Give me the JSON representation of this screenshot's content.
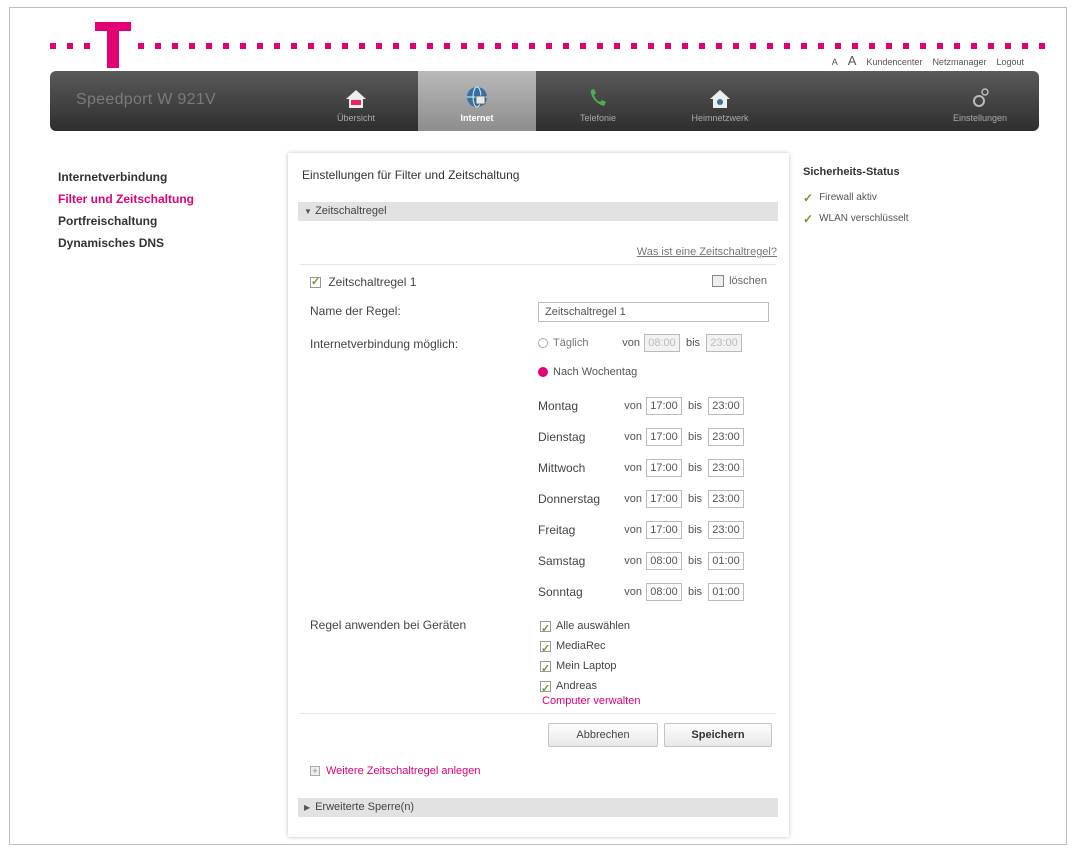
{
  "header": {
    "font_small": "A",
    "font_large": "A",
    "links": [
      "Kundencenter",
      "Netzmanager",
      "Logout"
    ]
  },
  "navbar": {
    "brand": "Speedport W 921V",
    "tabs": [
      {
        "label": "Übersicht",
        "icon": "house-icon"
      },
      {
        "label": "Internet",
        "icon": "globe-icon",
        "active": true
      },
      {
        "label": "Telefonie",
        "icon": "phone-icon"
      },
      {
        "label": "Heimnetzwerk",
        "icon": "home-network-icon"
      },
      {
        "label": "Einstellungen",
        "icon": "settings-icon"
      }
    ]
  },
  "sidebar": {
    "items": [
      {
        "label": "Internetverbindung",
        "active": false
      },
      {
        "label": "Filter und Zeitschaltung",
        "active": true
      },
      {
        "label": "Portfreischaltung",
        "active": false
      },
      {
        "label": "Dynamisches DNS",
        "active": false
      }
    ]
  },
  "main": {
    "title": "Einstellungen für Filter und Zeitschaltung",
    "section_rule": "Zeitschaltregel",
    "help_link": "Was ist eine Zeitschaltregel?",
    "rule": {
      "title": "Zeitschaltregel 1",
      "enabled": true,
      "delete_label": "löschen",
      "name_label": "Name der Regel:",
      "name_value": "Zeitschaltregel 1",
      "connection_label": "Internetverbindung möglich:",
      "daily_label": "Täglich",
      "daily_from": "08:00",
      "daily_to": "23:00",
      "weekday_label": "Nach Wochentag",
      "von": "von",
      "bis": "bis",
      "days": [
        {
          "day": "Montag",
          "from": "17:00",
          "to": "23:00"
        },
        {
          "day": "Dienstag",
          "from": "17:00",
          "to": "23:00"
        },
        {
          "day": "Mittwoch",
          "from": "17:00",
          "to": "23:00"
        },
        {
          "day": "Donnerstag",
          "from": "17:00",
          "to": "23:00"
        },
        {
          "day": "Freitag",
          "from": "17:00",
          "to": "23:00"
        },
        {
          "day": "Samstag",
          "from": "08:00",
          "to": "01:00"
        },
        {
          "day": "Sonntag",
          "from": "08:00",
          "to": "01:00"
        }
      ],
      "devices_label": "Regel anwenden bei Geräten",
      "devices": [
        {
          "label": "Alle auswählen",
          "checked": true
        },
        {
          "label": "MediaRec",
          "checked": true
        },
        {
          "label": "Mein Laptop",
          "checked": true
        },
        {
          "label": "Andreas",
          "checked": true
        }
      ],
      "manage_link": "Computer verwalten"
    },
    "cancel_button": "Abbrechen",
    "save_button": "Speichern",
    "add_rule": "Weitere Zeitschaltregel anlegen",
    "section_advanced": "Erweiterte Sperre(n)"
  },
  "status": {
    "title": "Sicherheits-Status",
    "items": [
      "Firewall aktiv",
      "WLAN verschlüsselt"
    ]
  },
  "colors": {
    "brand": "#e20074",
    "check": "#6a9a2a"
  }
}
